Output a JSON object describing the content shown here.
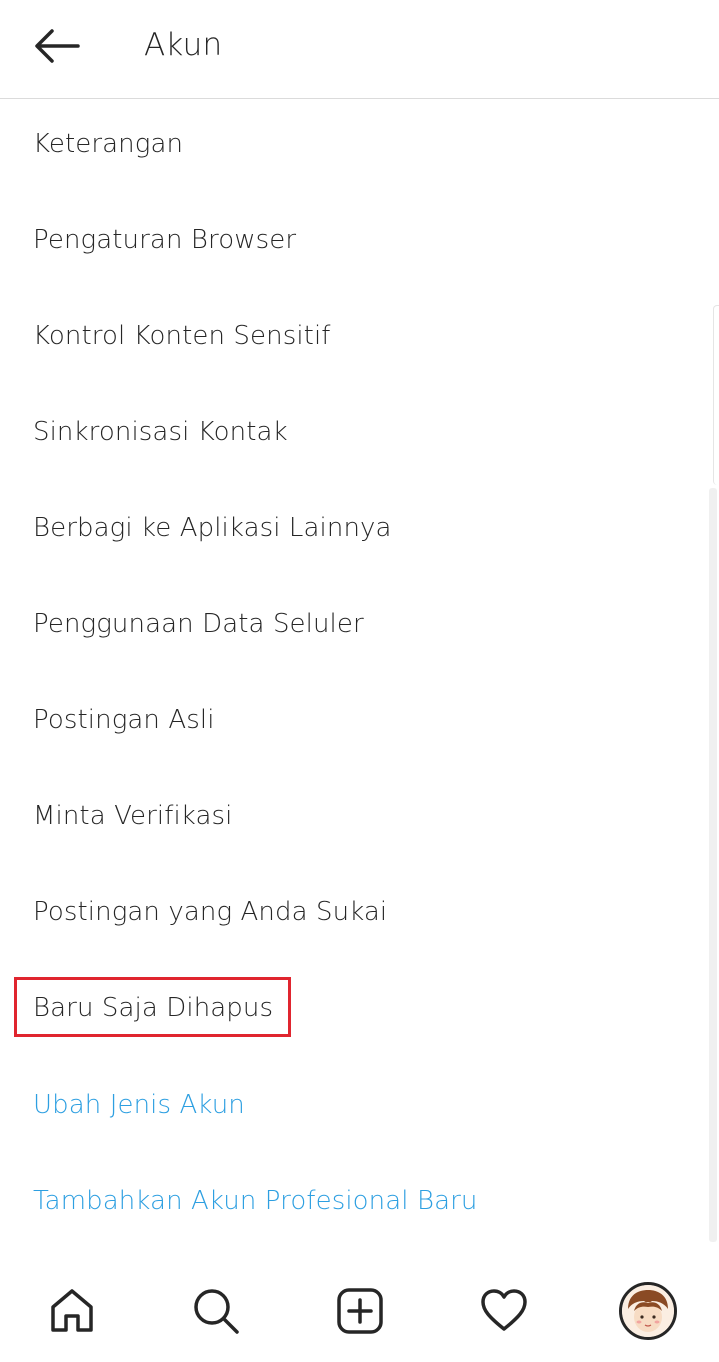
{
  "header": {
    "title": "Akun"
  },
  "menu": {
    "items": [
      {
        "label": "Keterangan",
        "type": "normal"
      },
      {
        "label": "Pengaturan Browser",
        "type": "normal"
      },
      {
        "label": "Kontrol Konten Sensitif",
        "type": "normal"
      },
      {
        "label": "Sinkronisasi Kontak",
        "type": "normal"
      },
      {
        "label": "Berbagi ke Aplikasi Lainnya",
        "type": "normal"
      },
      {
        "label": "Penggunaan Data Seluler",
        "type": "normal"
      },
      {
        "label": "Postingan Asli",
        "type": "normal"
      },
      {
        "label": "Minta Verifikasi",
        "type": "normal"
      },
      {
        "label": "Postingan yang Anda Sukai",
        "type": "normal"
      },
      {
        "label": "Baru Saja Dihapus",
        "type": "normal"
      },
      {
        "label": "Ubah Jenis Akun",
        "type": "link"
      },
      {
        "label": "Tambahkan Akun Profesional Baru",
        "type": "link"
      }
    ]
  },
  "tabbar": {
    "tabs": [
      {
        "icon": "home-icon"
      },
      {
        "icon": "search-icon"
      },
      {
        "icon": "new-post-icon"
      },
      {
        "icon": "heart-icon"
      },
      {
        "icon": "profile-avatar"
      }
    ]
  },
  "colors": {
    "text": "#262626",
    "link": "#2d9fe1",
    "highlight": "#e0252f",
    "divider": "#dbdbdb"
  }
}
